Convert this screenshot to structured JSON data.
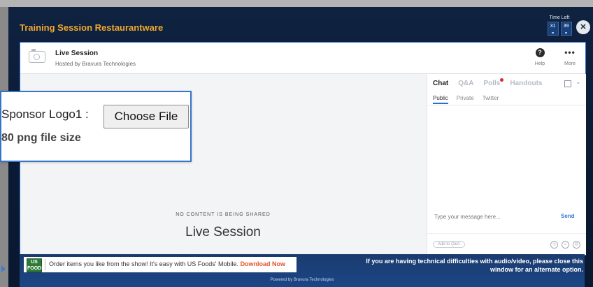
{
  "window": {
    "title": "Training Session Restaurantware",
    "time_left_label": "Time Left",
    "time_left": [
      "31",
      "39"
    ]
  },
  "header": {
    "session_name": "Live Session",
    "hosted_by": "Hosted by Bravura Technologies",
    "help_label": "Help",
    "more_label": "More"
  },
  "content": {
    "no_content_text": "NO CONTENT IS BEING SHARED",
    "title": "Live Session"
  },
  "chat": {
    "tabs": [
      "Chat",
      "Q&A",
      "Polls",
      "Handouts"
    ],
    "subtabs": [
      "Public",
      "Private",
      "Twitter"
    ],
    "message_placeholder": "Type your message here...",
    "send_label": "Send",
    "add_qa_label": "Add to Q&A"
  },
  "popup": {
    "label": "Sponsor Logo1 :",
    "button_label": "Choose File",
    "size_text": "80 png file size"
  },
  "banner": {
    "logo_text": "US FOODS",
    "ad_text": "Order items you like from the show! It's easy with US Foods' Mobile.",
    "ad_cta": "Download Now",
    "tech_note": "If you are having technical difficulties with audio/video, please close this window for an alternate option.",
    "powered_by": "Powered by Bravura Technologies"
  },
  "colors": {
    "accent_title": "#f2a72e",
    "frame_bg": "#0f2240",
    "panel_border": "#2e6fd2",
    "polls_badge": "#e0262b",
    "cta": "#e2532a"
  },
  "icons": [
    "camera-icon",
    "help-icon",
    "more-icon",
    "close-icon",
    "popout-icon",
    "chevron-down-icon",
    "us-foods-logo"
  ]
}
